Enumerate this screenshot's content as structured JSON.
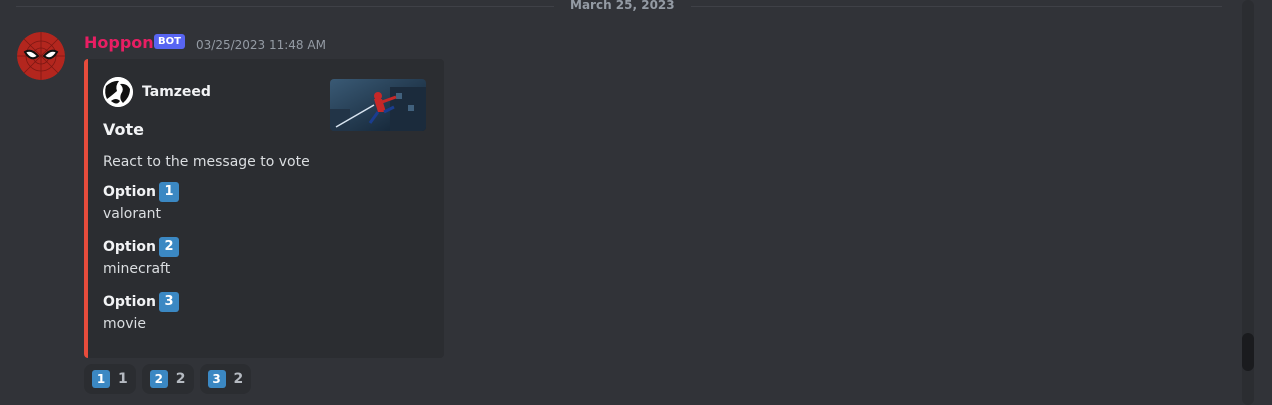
{
  "divider": {
    "date": "March 25, 2023"
  },
  "message": {
    "username": "Hoppon",
    "badge": "BOT",
    "timestamp": "03/25/2023 11:48 AM"
  },
  "embed": {
    "author": "Tamzeed",
    "title": "Vote",
    "description": "React to the message to vote",
    "fields": [
      {
        "name": "Option",
        "emoji": "1",
        "value": "valorant"
      },
      {
        "name": "Option",
        "emoji": "2",
        "value": "minecraft"
      },
      {
        "name": "Option",
        "emoji": "3",
        "value": "movie"
      }
    ],
    "accent_color": "#e74c3c"
  },
  "reactions": [
    {
      "emoji": "1",
      "count": "1"
    },
    {
      "emoji": "2",
      "count": "2"
    },
    {
      "emoji": "3",
      "count": "2"
    }
  ],
  "icons": {
    "avatar": "spiderman-mask-avatar",
    "author_icon": "black-white-avatar",
    "thumbnail": "spiderman-image"
  },
  "colors": {
    "background": "#313338",
    "username": "#e91e63",
    "bot_badge": "#5865f2",
    "keycap": "#3b88c3"
  }
}
